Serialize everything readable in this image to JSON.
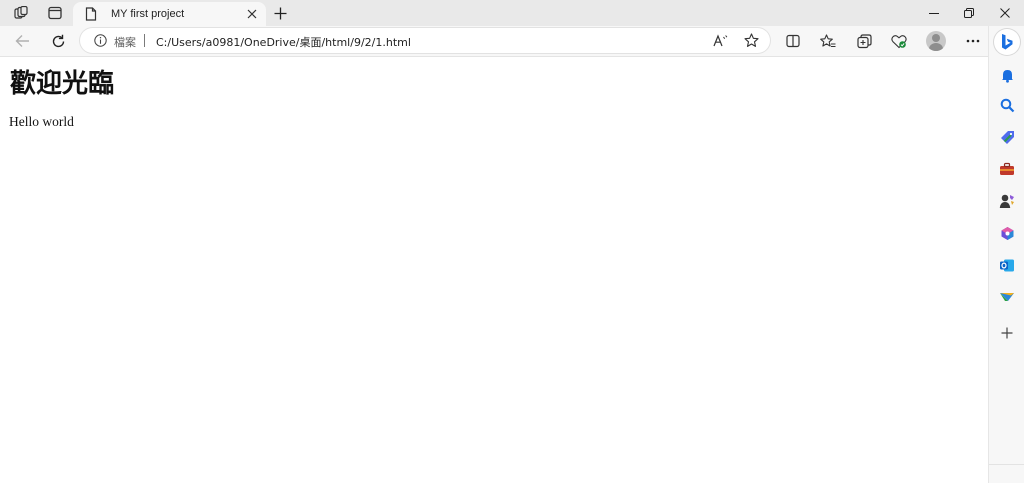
{
  "tab": {
    "title": "MY first project"
  },
  "address_bar": {
    "scheme_label": "檔案",
    "url": "C:/Users/a0981/OneDrive/桌面/html/9/2/1.html"
  },
  "page": {
    "heading": "歡迎光臨",
    "paragraph": "Hello world"
  },
  "icons": {
    "tab_strip": [
      "workspaces-icon",
      "vertical-tabs-icon",
      "page-icon",
      "close-icon",
      "new-tab-icon"
    ],
    "window": [
      "minimize-icon",
      "restore-icon",
      "window-close-icon"
    ],
    "toolbar": [
      "back-icon",
      "refresh-icon",
      "info-icon",
      "read-aloud-icon",
      "favorite-star-icon",
      "split-screen-icon",
      "favorites-icon",
      "collections-icon",
      "browser-essentials-icon",
      "profile-avatar",
      "more-icon"
    ],
    "sidebar": [
      "bing-copilot-icon",
      "bell-icon",
      "search-icon",
      "shopping-tag-icon",
      "tools-icon",
      "games-icon",
      "m365-icon",
      "outlook-icon",
      "drop-icon",
      "add-icon"
    ]
  },
  "colors": {
    "tab_strip_bg": "#e9e9e9",
    "toolbar_bg": "#f7f7f7",
    "page_bg": "#ffffff",
    "bing_blue": "#1b6fe0"
  }
}
